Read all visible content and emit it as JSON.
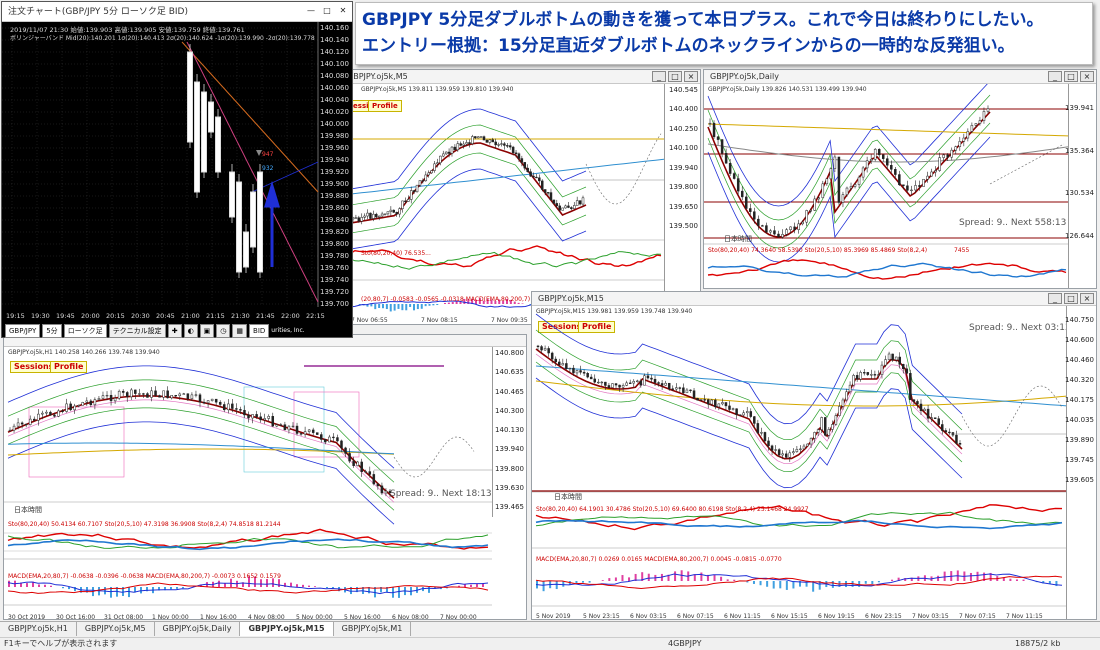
{
  "banner": {
    "line1": "GBPJPY 5分足ダブルボトムの動きを獲って本日プラス。これで今日は終わりにしたい。",
    "line2": "エントリー根拠：15分足直近ダブルボトムのネックラインからの一時的な反発狙い。"
  },
  "order_window": {
    "title": "注文チャート(GBP/JPY 5分 ローソク足 BID)",
    "info": "2019/11/07 21:30 始値:139.903 高値:139.905 安値:139.759 終値:139.761",
    "bb_label": "ボリンジャーバンド",
    "bb_values": "Mid(20):140.201 1σ(20):140.413 2σ(20):140.624 -1σ(20):139.990 -2σ(20):139.778",
    "price_ticks": [
      "140.160",
      "140.140",
      "140.120",
      "140.100",
      "140.080",
      "140.060",
      "140.040",
      "140.020",
      "140.000",
      "139.980",
      "139.960",
      "139.940",
      "139.920",
      "139.900",
      "139.880",
      "139.860",
      "139.840",
      "139.820",
      "139.800",
      "139.780",
      "139.760",
      "139.740",
      "139.720",
      "139.700"
    ],
    "time_ticks": [
      "19:15",
      "19:30",
      "19:45",
      "20:00",
      "20:15",
      "20:30",
      "20:45",
      "21:00",
      "21:15",
      "21:30",
      "21:45",
      "22:00",
      "22:15"
    ],
    "mark_947": "947",
    "mark_932": "932",
    "toolbar": {
      "pair": "GBP/JPY",
      "tf": "5分",
      "style": "ローソク足",
      "tech": "テクニカル設定",
      "bid": "BID",
      "brand": "urities, Inc."
    }
  },
  "m5": {
    "title": "GBPJPY.oj5k,M5",
    "ohlc": "GBPJPY.oj5k,M5  139.811 139.959 139.810 139.940",
    "price_ticks": [
      "140.545",
      "140.400",
      "140.250",
      "140.100",
      "139.940",
      "139.800",
      "139.650",
      "139.500"
    ],
    "current": "139.940",
    "osc_ticks": [
      "0.2975"
    ],
    "stoch": "Sto(80,20,40) 76.535...",
    "macd": "(20,80,7) -0.0583 -0.0565 -0.0318  MACD(EMA,80,200,7)",
    "time_ticks": [
      "7 Nov 06:55",
      "7 Nov 08:15",
      "7 Nov 09:35",
      "7 Nov 10:55"
    ],
    "sessions": "Sessions",
    "profile": "Profile"
  },
  "daily": {
    "title": "GBPJPY.oj5k,Daily",
    "ohlc": "GBPJPY.oj5k,Daily  139.826 140.531 139.499 139.940",
    "price_ticks": [
      "139.941",
      "135.364",
      "130.534",
      "126.644"
    ],
    "axis_ticks": [
      "",
      "",
      "",
      "",
      "",
      "",
      "",
      "",
      "",
      ""
    ],
    "spread": "Spread: 9.. Next 558:13",
    "tz": "日本時間",
    "stoch": "Sto(80,20,40) 74.3640 58.5390  Sto(20,5,10) 85.3969 85.4869  Sto(8,2,4)",
    "stoch_val": "7455"
  },
  "m15": {
    "title": "GBPJPY.oj5k,M15",
    "ohlc": "GBPJPY.oj5k,M15  139.981 139.959 139.748 139.940",
    "price_ticks": [
      "140.750",
      "140.600",
      "140.460",
      "140.320",
      "140.175",
      "140.035",
      "139.890",
      "139.745",
      "139.605"
    ],
    "current": "139.940",
    "level": "139.508",
    "spread": "Spread: 9.. Next 03:13",
    "tz": "日本時間",
    "sessions": "Sessions",
    "profile": "Profile",
    "stoch": "Sto(80,20,40) 64.1901 30.4786  Sto(20,5,10) 69.6400 80.6198  Sto(8,2,4) 25.1468 24.9927",
    "osc_ticks": [
      "80",
      "20"
    ],
    "macd": "MACD(EMA,20,80,7) 0.0269 0.0165  MACD(EMA,80,200,7) 0.0045 -0.0815 -0.0770",
    "macd_ticks": [
      "0.245",
      "0.332"
    ],
    "time_ticks": [
      "5 Nov 2019",
      "5 Nov 23:15",
      "6 Nov 03:15",
      "6 Nov 07:15",
      "6 Nov 11:15",
      "6 Nov 15:15",
      "6 Nov 19:15",
      "6 Nov 23:15",
      "7 Nov 03:15",
      "7 Nov 07:15",
      "7 Nov 11:15"
    ]
  },
  "h1": {
    "title": "GBPJPY.oj5k,H1",
    "ohlc": "GBPJPY.oj5k,H1  140.258 140.266 139.748 139.940",
    "price_ticks": [
      "140.800",
      "140.635",
      "140.465",
      "140.300",
      "140.130",
      "139.940",
      "139.800",
      "139.630",
      "139.465"
    ],
    "current": "139.940",
    "spread": "Spread: 9.. Next 18:13",
    "tz": "日本時間",
    "sessions": "Sessions",
    "profile": "Profile",
    "stoch": "Sto(80,20,40) 50.4134 60.7107  Sto(20,5,10) 47.3198 36.9908  Sto(8,2,4) 74.8518 81.2144",
    "macd": "MACD(EMA,20,80,7) -0.0638 -0.0396 -0.0638  MACD(EMA,80,200,7) -0.0073 0.1652 0.1579",
    "macd_ticks": [
      "0.2987",
      "0.218"
    ],
    "osc_ticks": [
      "80",
      "20"
    ],
    "time_ticks": [
      "30 Oct 2019",
      "30 Oct 16:00",
      "31 Oct 08:00",
      "1 Nov 00:00",
      "1 Nov 16:00",
      "4 Nov 08:00",
      "5 Nov 00:00",
      "5 Nov 16:00",
      "6 Nov 08:00",
      "7 Nov 00:00"
    ]
  },
  "tabs": [
    "GBPJPY.oj5k,H1",
    "GBPJPY.oj5k,M5",
    "GBPJPY.oj5k,Daily",
    "GBPJPY.oj5k,M15",
    "GBPJPY.oj5k,M1"
  ],
  "active_tab": 3,
  "status": {
    "help": "F1キーでヘルプが表示されます",
    "symbol": "4GBPJPY",
    "traffic": "18875/2 kb"
  },
  "colors": {
    "bull": "#1a1a1a",
    "bear": "#1a1a1a",
    "ma_red": "#8b0000",
    "bb_blue": "#1f2fd6",
    "ma_gold": "#d4a800",
    "ma_teal": "#2f8fd0",
    "accent": "#0a3aa8"
  }
}
